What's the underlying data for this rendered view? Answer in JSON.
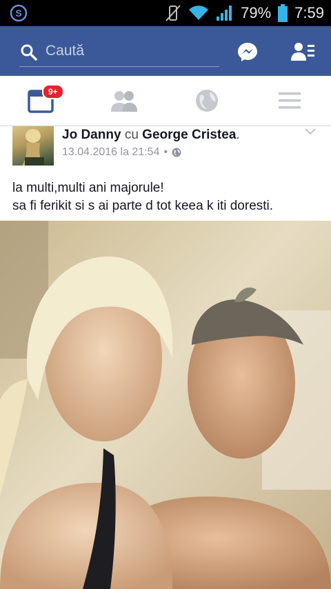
{
  "status_bar": {
    "battery": "79%",
    "time": "7:59"
  },
  "header": {
    "search_placeholder": "Caută"
  },
  "tabs": {
    "notifications_badge": "9+"
  },
  "post": {
    "author": "Jo Danny",
    "with_word": "cu",
    "tagged": "George Cristea",
    "period": ".",
    "timestamp": "13.04.2016 la 21:54",
    "separator": "•",
    "text_line1": "la multi,multi ani majorule!",
    "text_line2": "sa fi ferikit si s ai parte d tot keea k iti doresti."
  },
  "colors": {
    "brand": "#3b5998",
    "badge": "#e0252d",
    "status_bg": "#000000"
  }
}
